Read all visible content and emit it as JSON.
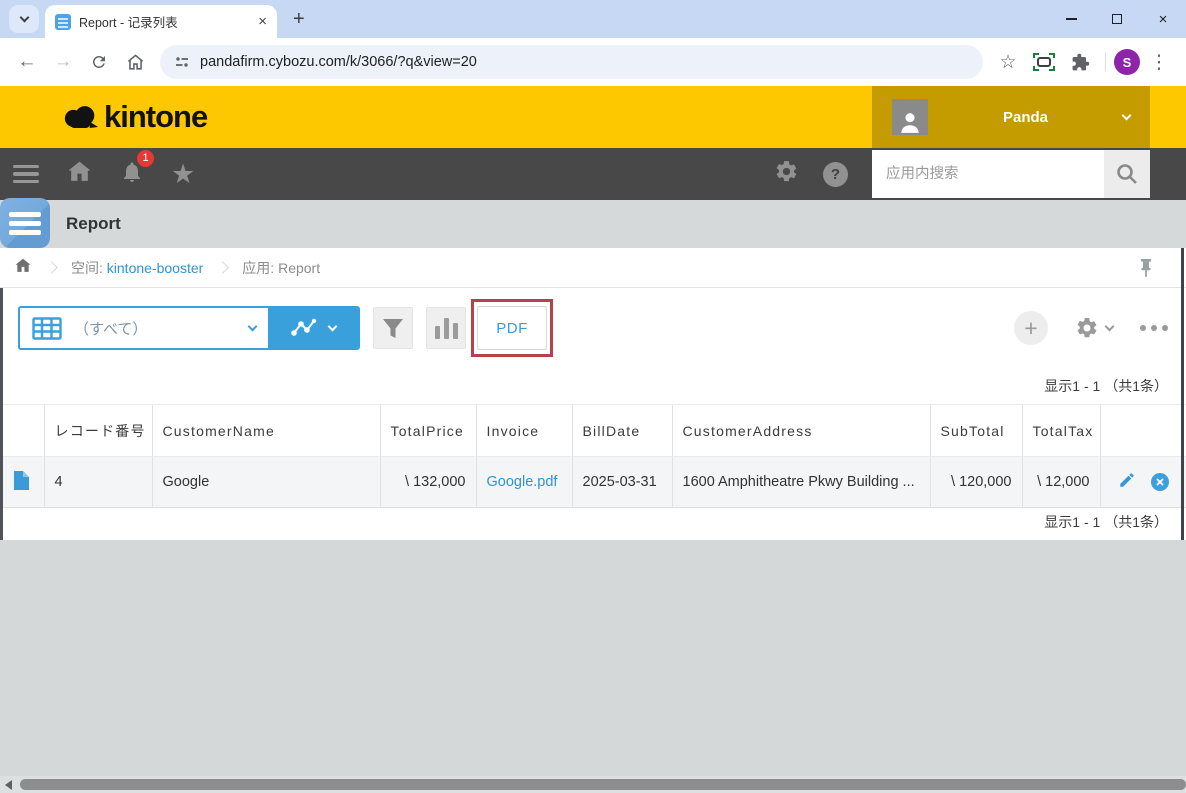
{
  "colors": {
    "brand_yellow": "#fdc800",
    "user_block_gold": "#c49c00",
    "nav_gray": "#484848",
    "accent_blue": "#3aa0db",
    "link_blue": "#3193d1",
    "highlight_red": "#b5434c",
    "badge_red": "#e53935",
    "profile_purple": "#8e24aa"
  },
  "icons": {
    "close": "×",
    "plus": "+",
    "minimize": "−",
    "back": "←",
    "forward": "→",
    "kebab": "⋮",
    "star_outline": "☆",
    "star_filled": "★",
    "question": "?"
  },
  "browser": {
    "tab_title": "Report - 记录列表",
    "url": "pandafirm.cybozu.com/k/3066/?q&view=20",
    "profile_initial": "S"
  },
  "header": {
    "logo": "kintone",
    "user": "Panda"
  },
  "nav": {
    "badge": "1",
    "search_placeholder": "应用内搜索"
  },
  "app": {
    "title": "Report"
  },
  "breadcrumb": {
    "space_label": "空间:",
    "space_name": "kintone-booster",
    "app_label": "应用:",
    "app_name": "Report"
  },
  "toolbar": {
    "view_label": "（すべて）",
    "pdf": "PDF"
  },
  "pagination": {
    "top": "显示1 - 1 （共1条）",
    "bottom": "显示1 - 1 （共1条）"
  },
  "table": {
    "headers": [
      "レコード番号",
      "CustomerName",
      "TotalPrice",
      "Invoice",
      "BillDate",
      "CustomerAddress",
      "SubTotal",
      "TotalTax"
    ],
    "row": {
      "record_no": "4",
      "customer_name": "Google",
      "total_price": "\\ 132,000",
      "invoice": "Google.pdf",
      "bill_date": "2025-03-31",
      "customer_address": "1600 Amphitheatre Pkwy Building ...",
      "sub_total": "\\ 120,000",
      "total_tax": "\\ 12,000"
    }
  }
}
